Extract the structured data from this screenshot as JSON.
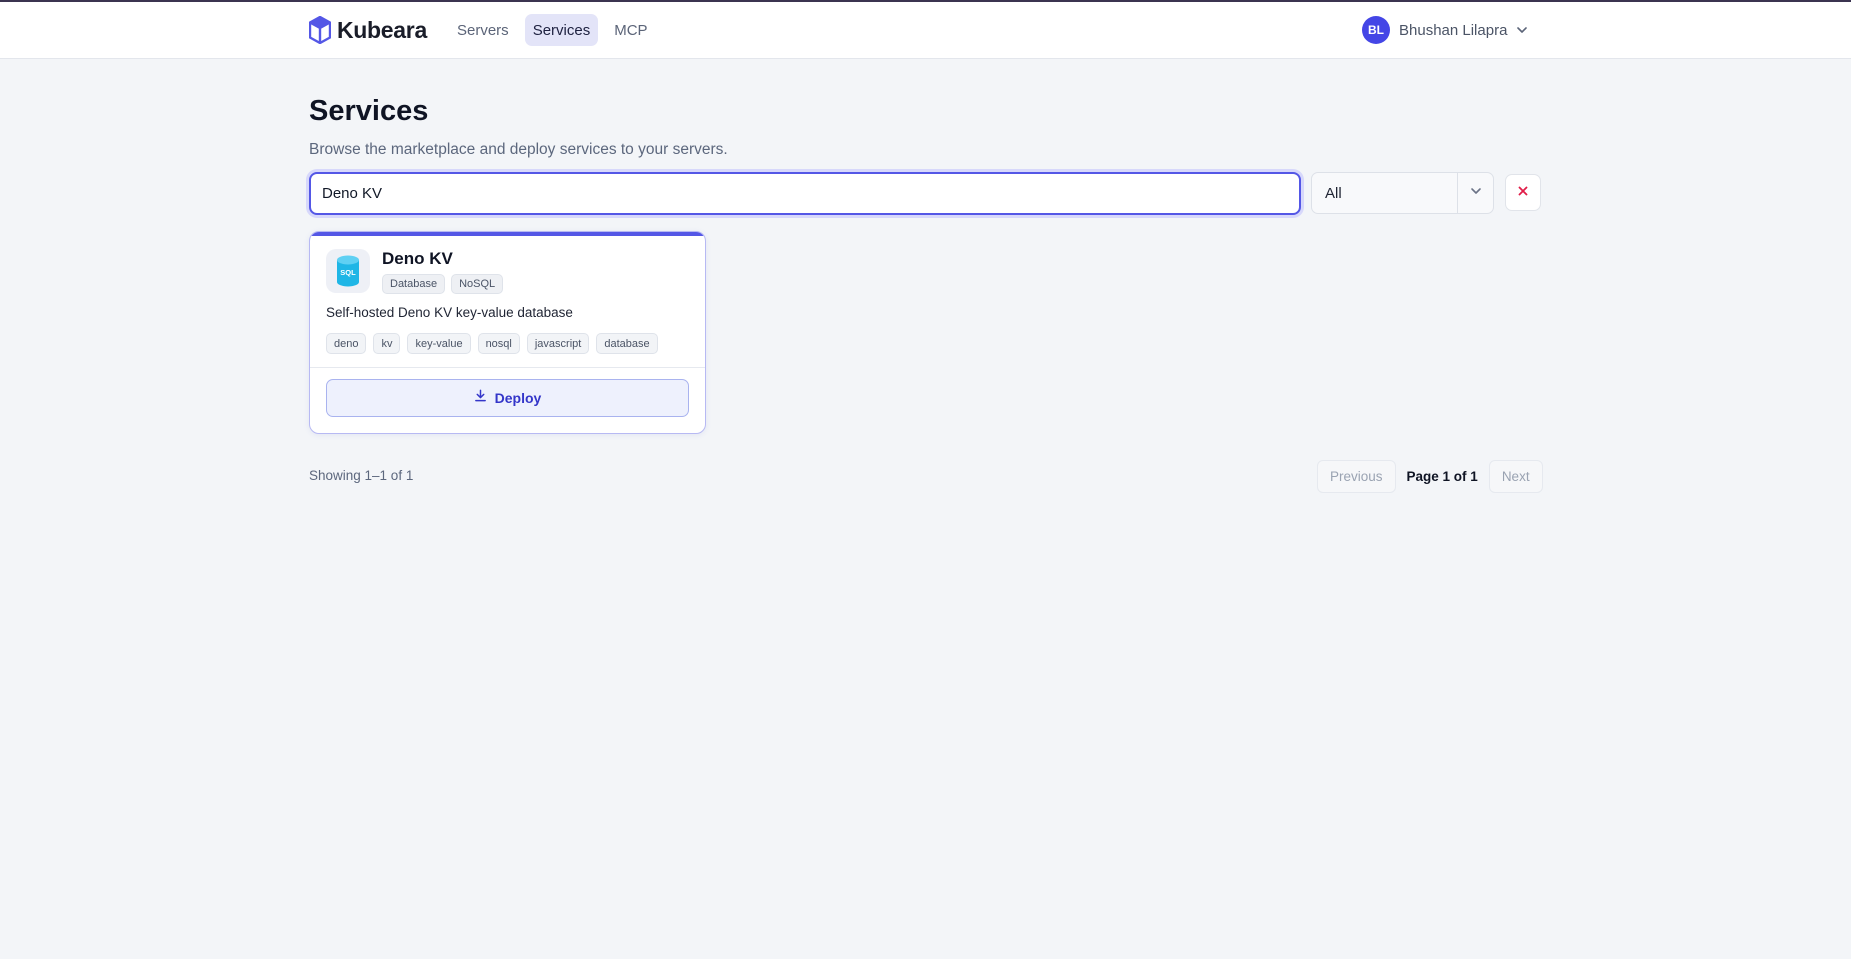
{
  "app": {
    "name": "Kubeara"
  },
  "nav": {
    "items": [
      {
        "label": "Servers",
        "active": false
      },
      {
        "label": "Services",
        "active": true
      },
      {
        "label": "MCP",
        "active": false
      }
    ]
  },
  "user": {
    "initials": "BL",
    "name": "Bhushan Lilapra"
  },
  "page": {
    "title": "Services",
    "subtitle": "Browse the marketplace and deploy services to your servers."
  },
  "filters": {
    "search_value": "Deno KV",
    "category_selected": "All"
  },
  "services": [
    {
      "name": "Deno KV",
      "icon": "sql-database-icon",
      "categories": [
        "Database",
        "NoSQL"
      ],
      "description": "Self-hosted Deno KV key-value database",
      "tags": [
        "deno",
        "kv",
        "key-value",
        "nosql",
        "javascript",
        "database"
      ],
      "action_label": "Deploy"
    }
  ],
  "pagination": {
    "showing": "Showing 1–1 of 1",
    "previous_label": "Previous",
    "page_info": "Page 1 of 1",
    "next_label": "Next"
  },
  "colors": {
    "accent": "#5457e6",
    "avatar": "#4446e6",
    "clear": "#e11d48",
    "sql_icon": "#1fb6e6"
  }
}
